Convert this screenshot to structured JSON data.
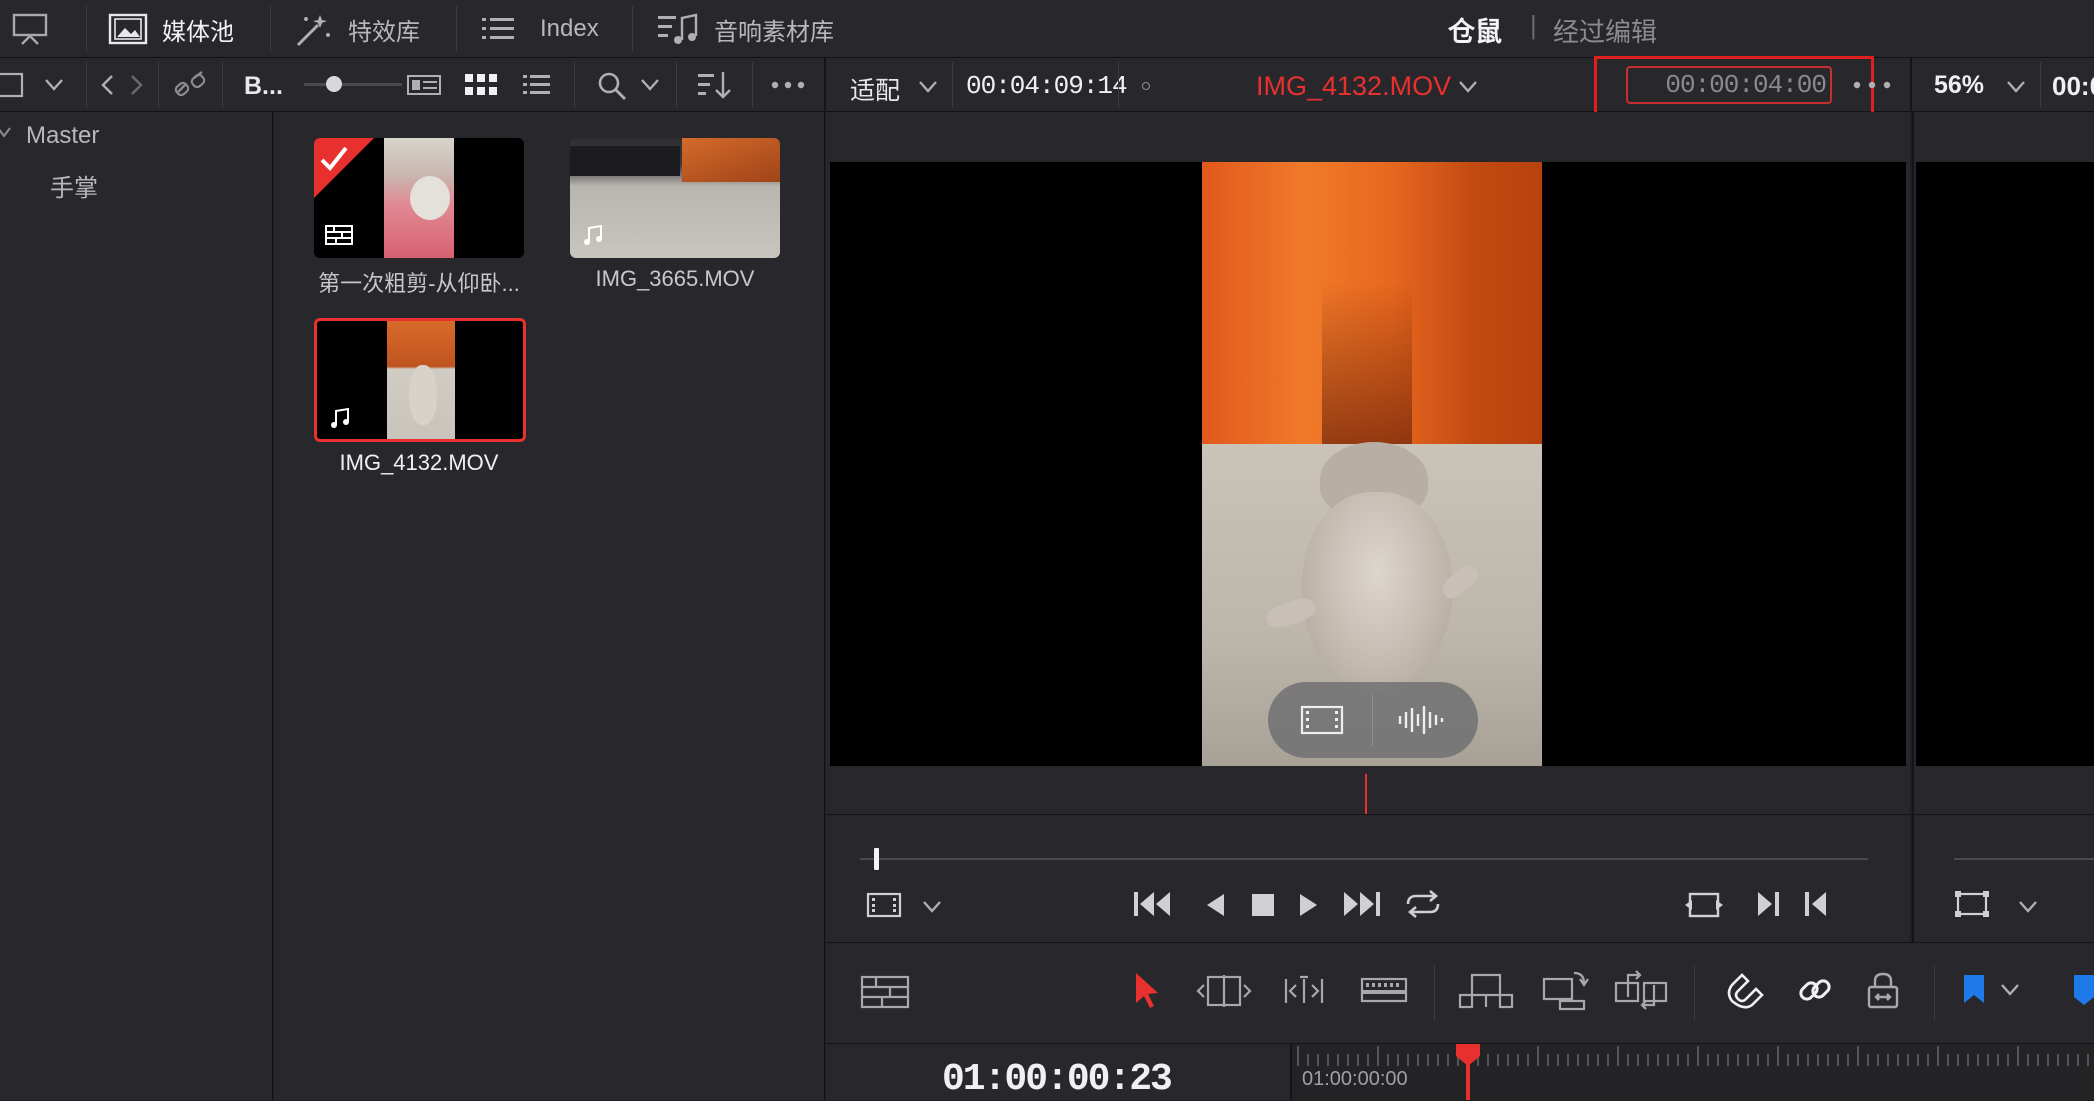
{
  "top_toolbar": {
    "media_pool": "媒体池",
    "effects": "特效库",
    "index": "Index",
    "sound_library": "音响素材库",
    "project_name": "仓鼠",
    "separator": "|",
    "mode": "经过编辑"
  },
  "pool_toolbar": {
    "bin_label": "B..."
  },
  "bins": {
    "master": "Master",
    "children": [
      "手掌"
    ]
  },
  "clips": [
    {
      "name": "第一次粗剪-从仰卧..."
    },
    {
      "name": "IMG_3665.MOV"
    },
    {
      "name": "IMG_4132.MOV"
    }
  ],
  "viewer": {
    "zoom_mode": "适配",
    "duration": "00:04:09:14",
    "clip_name": "IMG_4132.MOV",
    "timecode_input": "00:00:04:00",
    "right_zoom": "56%",
    "right_timecode_partial": "00:0"
  },
  "timeline": {
    "current_timecode": "01:00:00:23",
    "ruler_start": "01:00:00:00"
  },
  "colors": {
    "accent_red": "#e8302f",
    "highlight_box": "#e0201e",
    "marker_blue": "#1e7ae8"
  }
}
